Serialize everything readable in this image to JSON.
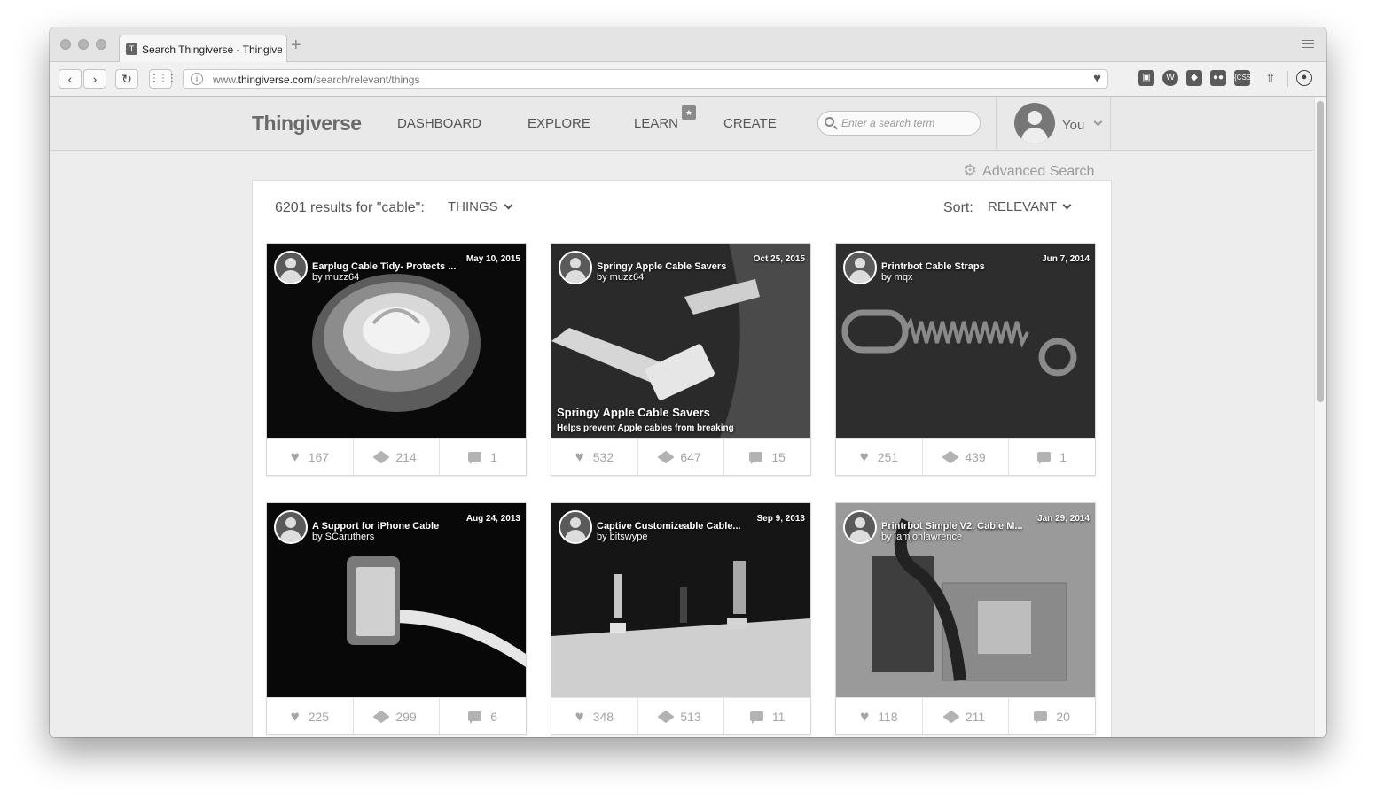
{
  "browser": {
    "tab_title": "Search Thingiverse - Thingiverse",
    "url_domain_prefix": "www.",
    "url_domain": "thingiverse.com",
    "url_path": "/search/relevant/things"
  },
  "site": {
    "logo": "Thingiverse",
    "nav": [
      "DASHBOARD",
      "EXPLORE",
      "LEARN",
      "CREATE"
    ],
    "search_placeholder": "Enter a search term",
    "user_label": "You",
    "advanced_search": "Advanced Search"
  },
  "results": {
    "summary": "6201 results for \"cable\":",
    "filter": "THINGS",
    "sort_label": "Sort:",
    "sort_value": "RELEVANT"
  },
  "cards": [
    {
      "title": "Earplug Cable Tidy- Protects ...",
      "author": "by muzz64",
      "date": "May 10, 2015",
      "likes": "167",
      "makes": "214",
      "comments": "1",
      "overlay_title": "",
      "overlay_sub": ""
    },
    {
      "title": "Springy Apple Cable Savers",
      "author": "by muzz64",
      "date": "Oct 25, 2015",
      "likes": "532",
      "makes": "647",
      "comments": "15",
      "overlay_title": "Springy Apple Cable Savers",
      "overlay_sub": "Helps prevent Apple cables from breaking"
    },
    {
      "title": "Printrbot Cable Straps",
      "author": "by mqx",
      "date": "Jun 7, 2014",
      "likes": "251",
      "makes": "439",
      "comments": "1",
      "overlay_title": "",
      "overlay_sub": ""
    },
    {
      "title": "A Support for iPhone Cable",
      "author": "by SCaruthers",
      "date": "Aug 24, 2013",
      "likes": "225",
      "makes": "299",
      "comments": "6",
      "overlay_title": "",
      "overlay_sub": ""
    },
    {
      "title": "Captive Customizeable Cable...",
      "author": "by bitswype",
      "date": "Sep 9, 2013",
      "likes": "348",
      "makes": "513",
      "comments": "11",
      "overlay_title": "",
      "overlay_sub": ""
    },
    {
      "title": "Printrbot Simple V2. Cable M...",
      "author": "by iamjonlawrence",
      "date": "Jan 29, 2014",
      "likes": "118",
      "makes": "211",
      "comments": "20",
      "overlay_title": "",
      "overlay_sub": ""
    }
  ]
}
